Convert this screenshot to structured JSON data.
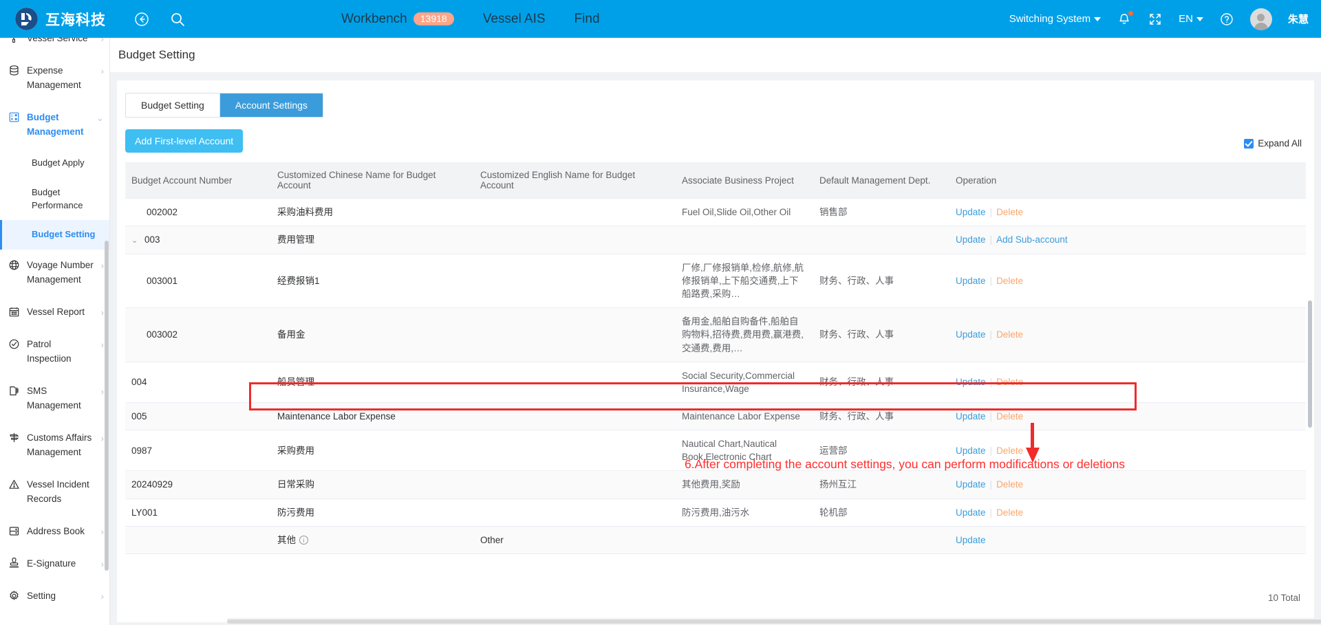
{
  "topbar": {
    "brand": "互海科技",
    "back_icon": "back-arrow-icon",
    "search_icon": "search-icon",
    "nav": [
      {
        "label": "Workbench",
        "badge": "13918"
      },
      {
        "label": "Vessel AIS",
        "badge": ""
      },
      {
        "label": "Find",
        "badge": ""
      }
    ],
    "switching_system": "Switching System",
    "language": "EN",
    "user_name": "朱慧",
    "bell_icon": "bell-icon",
    "fullscreen_icon": "fullscreen-icon",
    "help_icon": "help-circle-icon",
    "accent": "#00A0E9"
  },
  "sidebar": {
    "items": [
      {
        "label": "Vessel Service",
        "icon": "paint-roller-icon",
        "arrow": "›",
        "active": false
      },
      {
        "label": "Expense Management",
        "icon": "database-icon",
        "arrow": "›",
        "active": false
      },
      {
        "label": "Budget Management",
        "icon": "budget-grid-icon",
        "arrow": "⌄",
        "active": true
      }
    ],
    "sub_items": [
      {
        "label": "Budget Apply",
        "selected": false
      },
      {
        "label": "Budget Performance",
        "selected": false
      },
      {
        "label": "Budget Setting",
        "selected": true
      }
    ],
    "items_after": [
      {
        "label": "Voyage Number Management",
        "icon": "globe-icon",
        "arrow": "›"
      },
      {
        "label": "Vessel Report",
        "icon": "calendar-icon",
        "arrow": "›"
      },
      {
        "label": "Patrol Inspectiion",
        "icon": "check-circle-icon",
        "arrow": "›"
      },
      {
        "label": "SMS Management",
        "icon": "documents-icon",
        "arrow": "›"
      },
      {
        "label": "Customs Affairs Management",
        "icon": "signpost-icon",
        "arrow": "›"
      },
      {
        "label": "Vessel Incident Records",
        "icon": "warning-triangle-icon",
        "arrow": ""
      },
      {
        "label": "Address Book",
        "icon": "address-book-icon",
        "arrow": "›"
      },
      {
        "label": "E-Signature",
        "icon": "stamp-icon",
        "arrow": "›"
      },
      {
        "label": "Setting",
        "icon": "gear-icon",
        "arrow": "›"
      }
    ]
  },
  "page": {
    "title": "Budget Setting",
    "tabs": [
      {
        "label": "Budget Setting",
        "active": false
      },
      {
        "label": "Account Settings",
        "active": true
      }
    ],
    "add_button": "Add First-level Account",
    "expand_all": "Expand All",
    "total": "10 Total"
  },
  "table": {
    "columns": [
      "Budget Account Number",
      "Customized Chinese Name for Budget Account",
      "Customized English Name for Budget Account",
      "Associate Business Project",
      "Default Management Dept.",
      "Operation"
    ],
    "rows": [
      {
        "number": "002002",
        "level": 2,
        "caret": "",
        "cn_name": "采购油料费用",
        "en_name": "",
        "assoc": "Fuel Oil,Slide Oil,Other Oil",
        "dept": "销售部",
        "ops": [
          "Update",
          "Delete"
        ]
      },
      {
        "number": "003",
        "level": 1,
        "caret": "⌄",
        "cn_name": "费用管理",
        "en_name": "",
        "assoc": "",
        "dept": "",
        "ops": [
          "Update",
          "Add Sub-account"
        ]
      },
      {
        "number": "003001",
        "level": 2,
        "caret": "",
        "cn_name": "经费报销1",
        "en_name": "",
        "assoc": "厂修,厂修报销单,检修,航修,航修报销单,上下船交通费,上下船路费,采购…",
        "dept": "财务、行政、人事",
        "ops": [
          "Update",
          "Delete"
        ]
      },
      {
        "number": "003002",
        "level": 2,
        "caret": "",
        "cn_name": "备用金",
        "en_name": "",
        "assoc": "备用金,船舶自购备件,船舶自购物料,招待费,费用费,赢港费,交通费,费用,…",
        "dept": "财务、行政、人事",
        "ops": [
          "Update",
          "Delete"
        ]
      },
      {
        "number": "004",
        "level": 1,
        "caret": "",
        "cn_name": "船员管理",
        "en_name": "",
        "assoc": "Social Security,Commercial Insurance,Wage",
        "dept": "财务、行政、人事",
        "ops": [
          "Update",
          "Delete"
        ]
      },
      {
        "number": "005",
        "level": 1,
        "caret": "",
        "cn_name": "Maintenance Labor Expense",
        "en_name": "",
        "assoc": "Maintenance Labor Expense",
        "dept": "财务、行政、人事",
        "ops": [
          "Update",
          "Delete"
        ],
        "highlighted": true
      },
      {
        "number": "0987",
        "level": 1,
        "caret": "",
        "cn_name": "采购费用",
        "en_name": "",
        "assoc": "Nautical Chart,Nautical Book,Electronic Chart",
        "dept": "运营部",
        "ops": [
          "Update",
          "Delete"
        ]
      },
      {
        "number": "20240929",
        "level": 1,
        "caret": "",
        "cn_name": "日常采购",
        "en_name": "",
        "assoc": "其他费用,奖励",
        "dept": "扬州互江",
        "ops": [
          "Update",
          "Delete"
        ]
      },
      {
        "number": "LY001",
        "level": 1,
        "caret": "",
        "cn_name": "防污费用",
        "en_name": "",
        "assoc": "防污费用,油污水",
        "dept": "轮机部",
        "ops": [
          "Update",
          "Delete"
        ]
      },
      {
        "number": "",
        "level": 1,
        "caret": "",
        "cn_name": "其他",
        "cn_info": true,
        "en_name": "Other",
        "assoc": "",
        "dept": "",
        "ops": [
          "Update"
        ]
      }
    ]
  },
  "annotation": {
    "text": "6.After completing the account settings, you can perform modifications or deletions",
    "color": "#FF2D2D",
    "arrow": "down-arrow-annotation",
    "highlight_box": "highlight-rect-row-005"
  }
}
